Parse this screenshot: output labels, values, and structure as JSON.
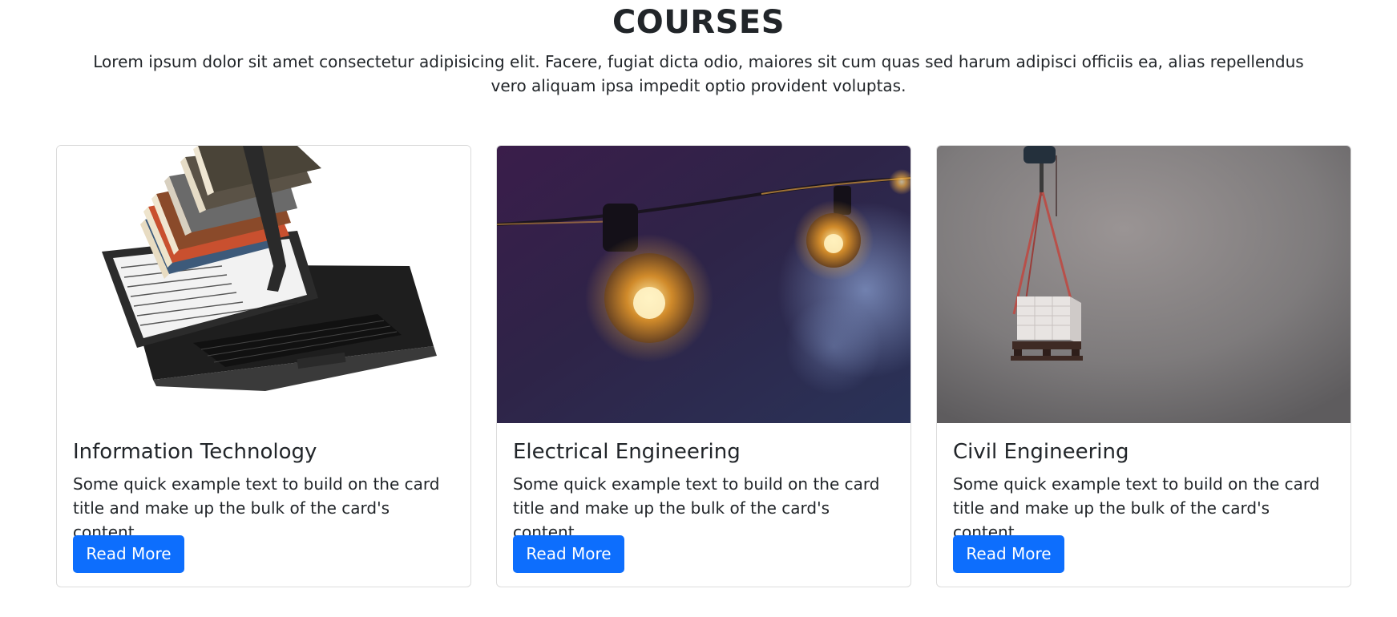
{
  "section": {
    "title": "COURSES",
    "description": "Lorem ipsum dolor sit amet consectetur adipisicing elit. Facere, fugiat dicta odio, maiores sit cum quas sed harum adipisci officiis ea, alias repellendus vero aliquam ipsa impedit optio provident voluptas."
  },
  "cards": [
    {
      "title": "Information Technology",
      "text": "Some quick example text to build on the card title and make up the bulk of the card's content.",
      "button_label": "Read More",
      "image": "books-on-laptop-image"
    },
    {
      "title": "Electrical Engineering",
      "text": "Some quick example text to build on the card title and make up the bulk of the card's content.",
      "button_label": "Read More",
      "image": "light-bulbs-image"
    },
    {
      "title": "Civil Engineering",
      "text": "Some quick example text to build on the card title and make up the bulk of the card's content.",
      "button_label": "Read More",
      "image": "crane-lifting-bricks-image"
    }
  ],
  "colors": {
    "accent": "#0d6efd",
    "text": "#212529",
    "card_border": "#dcdcdc"
  }
}
